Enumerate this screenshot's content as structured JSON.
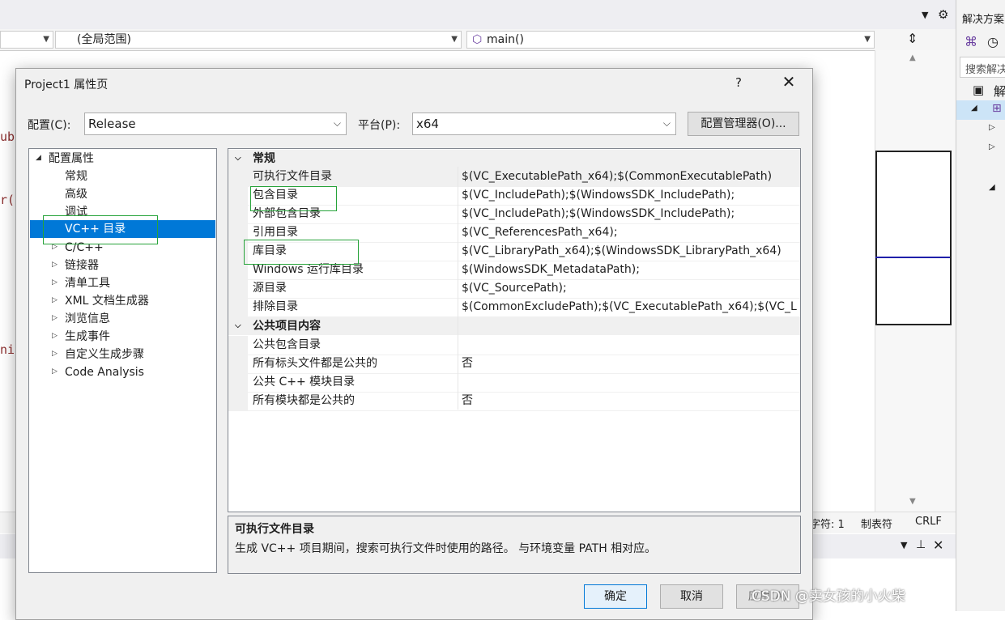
{
  "ide": {
    "scope_value": "(全局范围)",
    "function_value": "main()",
    "right_panel_title": "解决方案",
    "right_panel_search": "搜索解决",
    "right_panel_item": "解",
    "code_frags": [
      "ubs",
      "r(s",
      "nis"
    ],
    "status_char": "字符: 1",
    "status_tabs": "制表符",
    "status_eol": "CRLF"
  },
  "dialog": {
    "title": "Project1 属性页",
    "help": "?",
    "close": "✕",
    "config_label": "配置(C):",
    "config_value": "Release",
    "platform_label": "平台(P):",
    "platform_value": "x64",
    "config_manager": "配置管理器(O)...",
    "tree": {
      "root": "配置属性",
      "items": [
        "常规",
        "高级",
        "调试",
        "VC++ 目录",
        "C/C++",
        "链接器",
        "清单工具",
        "XML 文档生成器",
        "浏览信息",
        "生成事件",
        "自定义生成步骤",
        "Code Analysis"
      ]
    },
    "grid": {
      "cat1": "常规",
      "cat2": "公共项目内容",
      "rows1": [
        {
          "name": "可执行文件目录",
          "value": "$(VC_ExecutablePath_x64);$(CommonExecutablePath)"
        },
        {
          "name": "包含目录",
          "value": "$(VC_IncludePath);$(WindowsSDK_IncludePath);"
        },
        {
          "name": "外部包含目录",
          "value": "$(VC_IncludePath);$(WindowsSDK_IncludePath);"
        },
        {
          "name": "引用目录",
          "value": "$(VC_ReferencesPath_x64);"
        },
        {
          "name": "库目录",
          "value": "$(VC_LibraryPath_x64);$(WindowsSDK_LibraryPath_x64)"
        },
        {
          "name": "Windows 运行库目录",
          "value": "$(WindowsSDK_MetadataPath);"
        },
        {
          "name": "源目录",
          "value": "$(VC_SourcePath);"
        },
        {
          "name": "排除目录",
          "value": "$(CommonExcludePath);$(VC_ExecutablePath_x64);$(VC_L"
        }
      ],
      "rows2": [
        {
          "name": "公共包含目录",
          "value": ""
        },
        {
          "name": "所有标头文件都是公共的",
          "value": "否"
        },
        {
          "name": "公共 C++ 模块目录",
          "value": ""
        },
        {
          "name": "所有模块都是公共的",
          "value": "否"
        }
      ]
    },
    "desc_title": "可执行文件目录",
    "desc_text": "生成 VC++ 项目期间，搜索可执行文件时使用的路径。 与环境变量 PATH 相对应。",
    "ok": "确定",
    "cancel": "取消",
    "apply": "应用(A)"
  },
  "watermark": "CSDN @卖女孩的小火柴",
  "colors": {
    "selection": "#0078d7",
    "highlight_box": "#27a33a"
  }
}
